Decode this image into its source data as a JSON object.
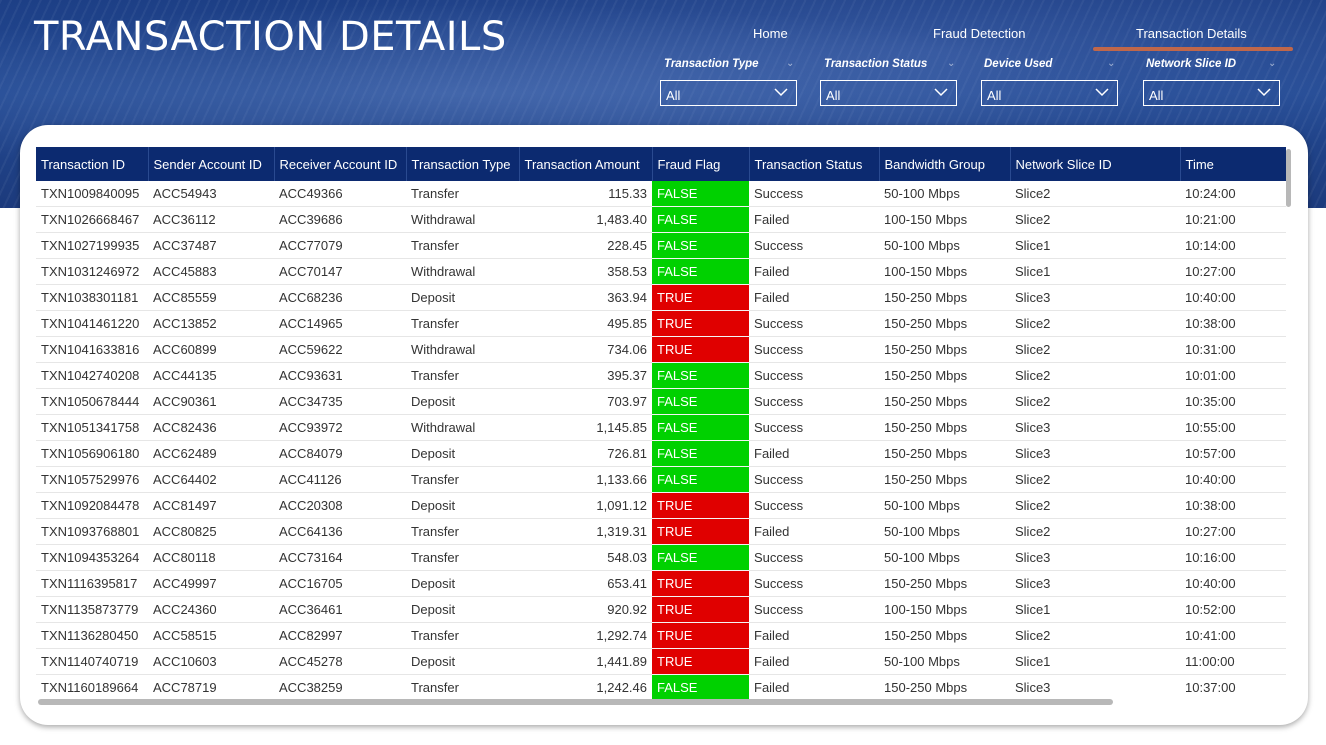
{
  "page": {
    "title": "TRANSACTION DETAILS"
  },
  "nav": {
    "home": "Home",
    "fraud": "Fraud Detection",
    "details": "Transaction Details"
  },
  "filters": [
    {
      "label": "Transaction Type",
      "value": "All"
    },
    {
      "label": "Transaction Status",
      "value": "All"
    },
    {
      "label": "Device Used",
      "value": "All"
    },
    {
      "label": "Network Slice ID",
      "value": "All"
    }
  ],
  "colors": {
    "header": "#1d3f86",
    "table_header": "#0c2a70",
    "flag_false": "#00d100",
    "flag_true": "#e00000",
    "nav_underline": "#c0674a"
  },
  "table": {
    "headers": [
      "Transaction ID",
      "Sender Account ID",
      "Receiver Account ID",
      "Transaction Type",
      "Transaction Amount",
      "Fraud Flag",
      "Transaction Status",
      "Bandwidth Group",
      "Network Slice ID",
      "Time"
    ],
    "rows": [
      [
        "TXN1009840095",
        "ACC54943",
        "ACC49366",
        "Transfer",
        "115.33",
        "FALSE",
        "Success",
        "50-100 Mbps",
        "Slice2",
        "10:24:00"
      ],
      [
        "TXN1026668467",
        "ACC36112",
        "ACC39686",
        "Withdrawal",
        "1,483.40",
        "FALSE",
        "Failed",
        "100-150 Mbps",
        "Slice2",
        "10:21:00"
      ],
      [
        "TXN1027199935",
        "ACC37487",
        "ACC77079",
        "Transfer",
        "228.45",
        "FALSE",
        "Success",
        "50-100 Mbps",
        "Slice1",
        "10:14:00"
      ],
      [
        "TXN1031246972",
        "ACC45883",
        "ACC70147",
        "Withdrawal",
        "358.53",
        "FALSE",
        "Failed",
        "100-150 Mbps",
        "Slice1",
        "10:27:00"
      ],
      [
        "TXN1038301181",
        "ACC85559",
        "ACC68236",
        "Deposit",
        "363.94",
        "TRUE",
        "Failed",
        "150-250 Mbps",
        "Slice3",
        "10:40:00"
      ],
      [
        "TXN1041461220",
        "ACC13852",
        "ACC14965",
        "Transfer",
        "495.85",
        "TRUE",
        "Success",
        "150-250 Mbps",
        "Slice2",
        "10:38:00"
      ],
      [
        "TXN1041633816",
        "ACC60899",
        "ACC59622",
        "Withdrawal",
        "734.06",
        "TRUE",
        "Success",
        "150-250 Mbps",
        "Slice2",
        "10:31:00"
      ],
      [
        "TXN1042740208",
        "ACC44135",
        "ACC93631",
        "Transfer",
        "395.37",
        "FALSE",
        "Success",
        "150-250 Mbps",
        "Slice2",
        "10:01:00"
      ],
      [
        "TXN1050678444",
        "ACC90361",
        "ACC34735",
        "Deposit",
        "703.97",
        "FALSE",
        "Success",
        "150-250 Mbps",
        "Slice2",
        "10:35:00"
      ],
      [
        "TXN1051341758",
        "ACC82436",
        "ACC93972",
        "Withdrawal",
        "1,145.85",
        "FALSE",
        "Success",
        "150-250 Mbps",
        "Slice3",
        "10:55:00"
      ],
      [
        "TXN1056906180",
        "ACC62489",
        "ACC84079",
        "Deposit",
        "726.81",
        "FALSE",
        "Failed",
        "150-250 Mbps",
        "Slice3",
        "10:57:00"
      ],
      [
        "TXN1057529976",
        "ACC64402",
        "ACC41126",
        "Transfer",
        "1,133.66",
        "FALSE",
        "Success",
        "150-250 Mbps",
        "Slice2",
        "10:40:00"
      ],
      [
        "TXN1092084478",
        "ACC81497",
        "ACC20308",
        "Deposit",
        "1,091.12",
        "TRUE",
        "Success",
        "50-100 Mbps",
        "Slice2",
        "10:38:00"
      ],
      [
        "TXN1093768801",
        "ACC80825",
        "ACC64136",
        "Transfer",
        "1,319.31",
        "TRUE",
        "Failed",
        "50-100 Mbps",
        "Slice2",
        "10:27:00"
      ],
      [
        "TXN1094353264",
        "ACC80118",
        "ACC73164",
        "Transfer",
        "548.03",
        "FALSE",
        "Success",
        "50-100 Mbps",
        "Slice3",
        "10:16:00"
      ],
      [
        "TXN1116395817",
        "ACC49997",
        "ACC16705",
        "Deposit",
        "653.41",
        "TRUE",
        "Success",
        "150-250 Mbps",
        "Slice3",
        "10:40:00"
      ],
      [
        "TXN1135873779",
        "ACC24360",
        "ACC36461",
        "Deposit",
        "920.92",
        "TRUE",
        "Success",
        "100-150 Mbps",
        "Slice1",
        "10:52:00"
      ],
      [
        "TXN1136280450",
        "ACC58515",
        "ACC82997",
        "Transfer",
        "1,292.74",
        "TRUE",
        "Failed",
        "150-250 Mbps",
        "Slice2",
        "10:41:00"
      ],
      [
        "TXN1140740719",
        "ACC10603",
        "ACC45278",
        "Deposit",
        "1,441.89",
        "TRUE",
        "Failed",
        "50-100 Mbps",
        "Slice1",
        "11:00:00"
      ],
      [
        "TXN1160189664",
        "ACC78719",
        "ACC38259",
        "Transfer",
        "1,242.46",
        "FALSE",
        "Failed",
        "150-250 Mbps",
        "Slice3",
        "10:37:00"
      ]
    ]
  }
}
